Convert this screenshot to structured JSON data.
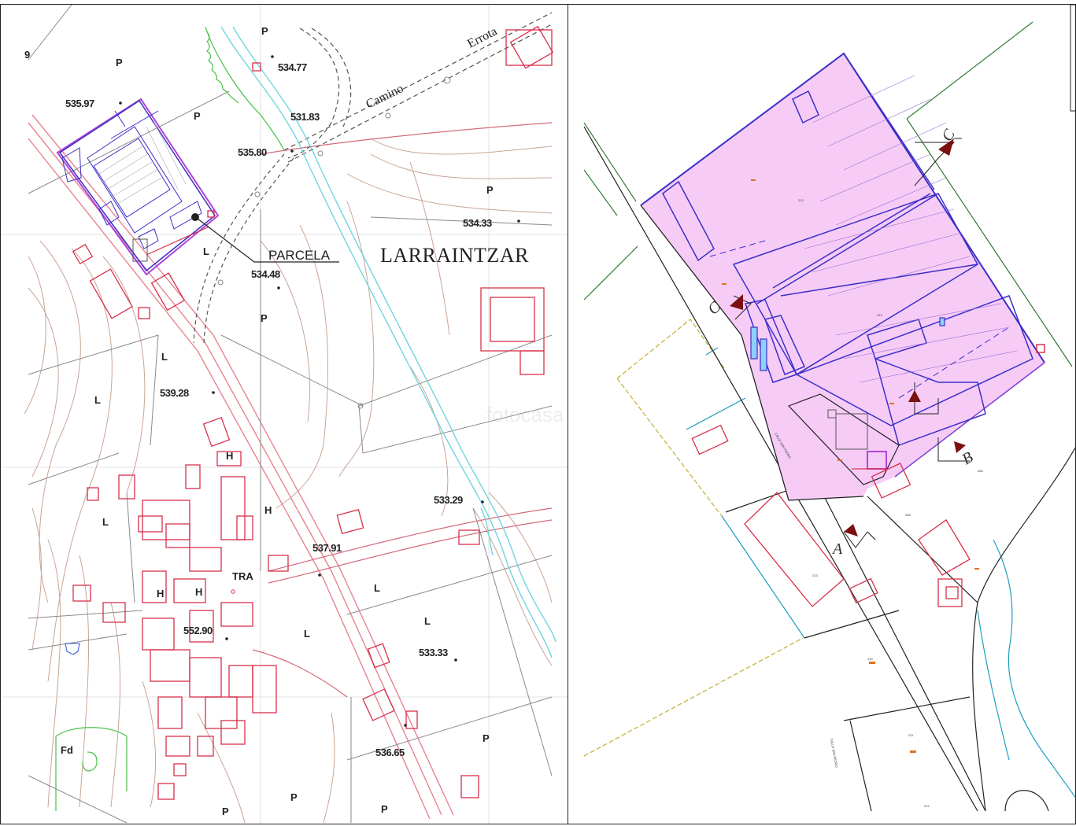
{
  "left_map": {
    "town_name": "LARRAINTZAR",
    "parcel_label": "PARCELA",
    "road_labels": [
      "Camino",
      "Errota"
    ],
    "elevations": [
      "534.77",
      "535.97",
      "531.83",
      "535.80",
      "534.33",
      "534.48",
      "539.28",
      "533.29",
      "537.91",
      "552.90",
      "533.33",
      "536.65"
    ],
    "zones": [
      "P",
      "L",
      "H",
      "TRA",
      "Fd"
    ],
    "partial_edge_text": "9"
  },
  "right_map": {
    "section_markers": [
      "A",
      "B",
      "C",
      "C"
    ],
    "parcel_numbers": [
      "212",
      "219",
      "286",
      "285",
      "213",
      "210",
      "211"
    ],
    "street_label": "CALLE SAN PEDRO"
  },
  "watermark": "fotocasa",
  "colors": {
    "parcel_outline": "#3b2fc9",
    "building": "#d9304a",
    "contour": "#b58b7a",
    "river": "#3fc9d4",
    "vegetation": "#3fbf3f",
    "highlight_fill": "#f6ccf6",
    "boundary_green": "#2e7d32",
    "boundary_yellow": "#c9b33a",
    "arrow": "#7a1010",
    "sewer_blue": "#1a9fc0"
  }
}
